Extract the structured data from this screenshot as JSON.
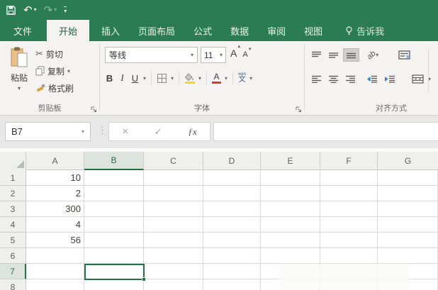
{
  "titlebar": {
    "undo_glyph": "↶",
    "redo_glyph": "↷",
    "dropdown_glyph": "▾"
  },
  "tabs": [
    {
      "label": "文件"
    },
    {
      "label": "开始"
    },
    {
      "label": "插入"
    },
    {
      "label": "页面布局"
    },
    {
      "label": "公式"
    },
    {
      "label": "数据"
    },
    {
      "label": "审阅"
    },
    {
      "label": "视图"
    },
    {
      "label": "告诉我"
    }
  ],
  "ribbon": {
    "clipboard": {
      "paste_label": "粘贴",
      "cut_label": "剪切",
      "copy_label": "复制",
      "format_painter_label": "格式刷",
      "group_label": "剪贴板",
      "scissors_glyph": "✂"
    },
    "font": {
      "font_name": "等线",
      "font_size": "11",
      "bold": "B",
      "italic": "I",
      "underline": "U",
      "grow_letter": "A",
      "shrink_letter": "A",
      "color_letter": "A",
      "phonetic_top": "wén",
      "phonetic_bottom": "文",
      "group_label": "字体"
    },
    "alignment": {
      "orientation_glyph": "ab",
      "group_label": "对齐方式"
    }
  },
  "formula_bar": {
    "name_box_value": "B7",
    "cancel_glyph": "×",
    "enter_glyph": "✓",
    "fx_glyph": "ƒx",
    "dots_glyph": "⋮"
  },
  "sheet": {
    "col_headers": [
      "A",
      "B",
      "C",
      "D",
      "E",
      "F",
      "G"
    ],
    "row_headers": [
      "1",
      "2",
      "3",
      "4",
      "5",
      "6",
      "7",
      "8"
    ],
    "colA_values": [
      "10",
      "2",
      "300",
      "4",
      "56"
    ],
    "selected_cell": "B7",
    "accent_color": "#217346"
  }
}
